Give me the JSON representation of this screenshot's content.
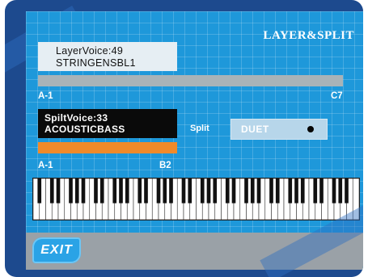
{
  "screen": {
    "title": "LAYER&SPLIT",
    "layer": {
      "voice_label": "LayerVoice:49",
      "voice_name": "STRINGENSBL1",
      "range_start": "A-1",
      "range_end": "C7"
    },
    "split": {
      "voice_label": "SpiltVoice:33",
      "voice_name": "ACOUSTICBASS",
      "range_start": "A-1",
      "range_end": "B2",
      "split_label": "Split",
      "duet_label": "DUET"
    },
    "exit_label": "EXIT"
  },
  "colors": {
    "screen_bg": "#1e98da",
    "layer_bar": "#a8b3b8",
    "split_bar": "#f08a2a",
    "bottom_bar": "#9aa1a7"
  },
  "keyboard": {
    "white_keys": 52,
    "icon": "piano-keyboard"
  }
}
